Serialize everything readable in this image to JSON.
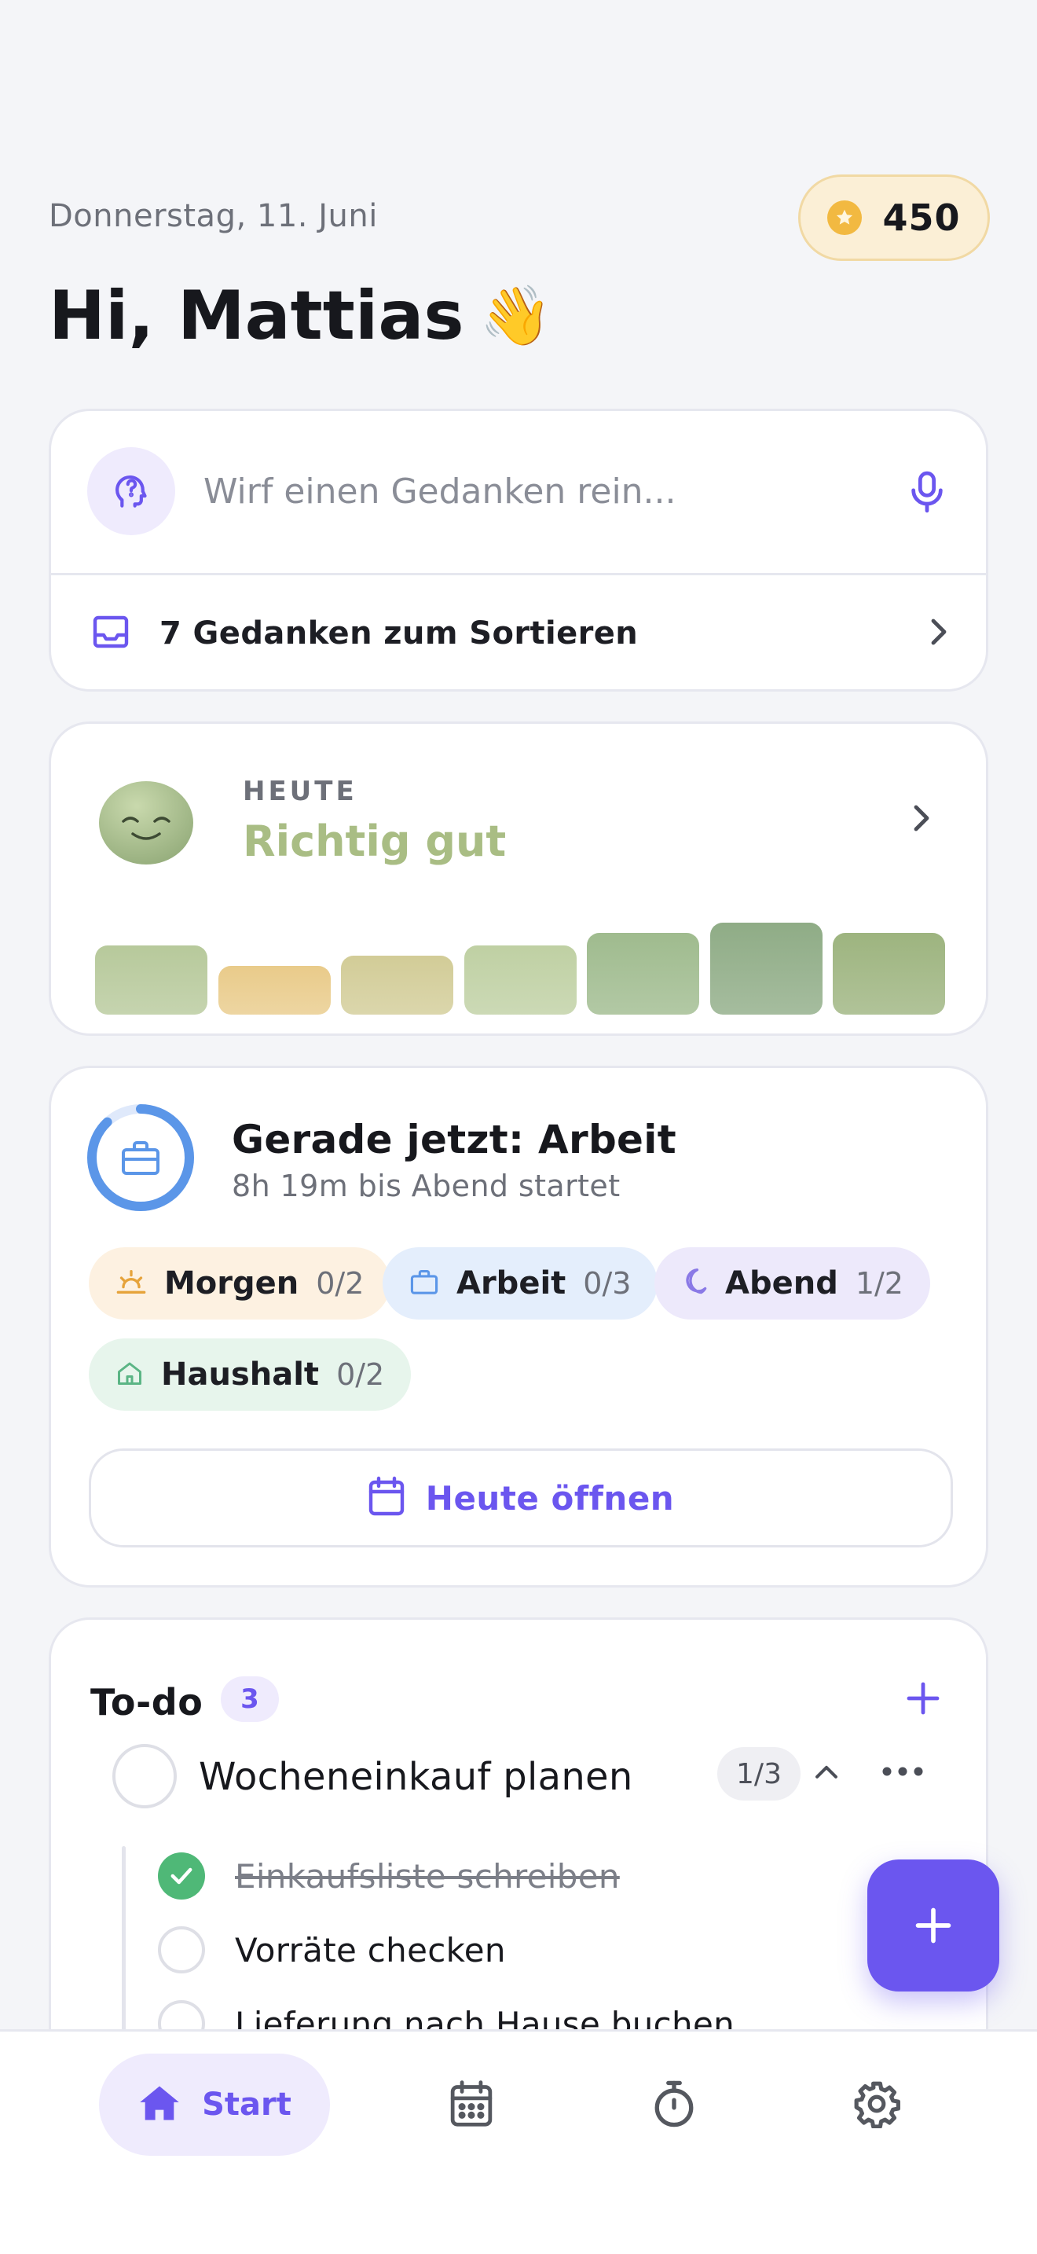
{
  "header": {
    "date": "Donnerstag, 11. Juni",
    "coins": "450",
    "greeting": "Hi, Mattias",
    "greeting_emoji": "👋"
  },
  "capture": {
    "placeholder": "Wirf einen Gedanken rein...",
    "sort_label": "7 Gedanken zum Sortieren",
    "icons": [
      "brain-question-icon",
      "microphone-icon",
      "inbox-icon",
      "chevron-right-icon"
    ]
  },
  "mood": {
    "kicker": "HEUTE",
    "title": "Richtig gut",
    "history_levels": [
      0.68,
      0.48,
      0.58,
      0.68,
      0.8,
      0.9,
      0.8
    ],
    "history_colors": [
      "#b7c99b",
      "#e9cb8a",
      "#d2cc97",
      "#bfd0a3",
      "#9fbb8e",
      "#8fac86",
      "#9db47f"
    ]
  },
  "day": {
    "now_title": "Gerade jetzt: Arbeit",
    "now_sub": "8h 19m bis Abend startet",
    "progress": 0.88,
    "chips": [
      {
        "label": "Morgen",
        "count": "0/2",
        "bg": "#fdf1e1",
        "icon": "sunrise-icon",
        "color": "#e6a33a"
      },
      {
        "label": "Arbeit",
        "count": "0/3",
        "bg": "#e4eefc",
        "icon": "briefcase-icon",
        "color": "#5b96e8"
      },
      {
        "label": "Abend",
        "count": "1/2",
        "bg": "#ede9fb",
        "icon": "moon-icon",
        "color": "#8a79e6"
      },
      {
        "label": "Haushalt",
        "count": "0/2",
        "bg": "#e7f5ec",
        "icon": "home-icon",
        "color": "#5bb585"
      }
    ],
    "open_label": "Heute öffnen"
  },
  "todo": {
    "title": "To-do",
    "badge": "3",
    "tasks": [
      {
        "label": "Wocheneinkauf planen",
        "count": "1/3",
        "subtasks": [
          {
            "label": "Einkaufsliste schreiben",
            "done": true
          },
          {
            "label": "Vorräte checken",
            "done": false
          },
          {
            "label": "Lieferung nach Hause buchen",
            "done": false
          }
        ]
      }
    ]
  },
  "nav": {
    "active_label": "Start",
    "items": [
      "home-icon",
      "calendar-icon",
      "timer-icon",
      "settings-icon"
    ]
  },
  "colors": {
    "accent": "#6b56ef",
    "background": "#f4f5f8"
  }
}
